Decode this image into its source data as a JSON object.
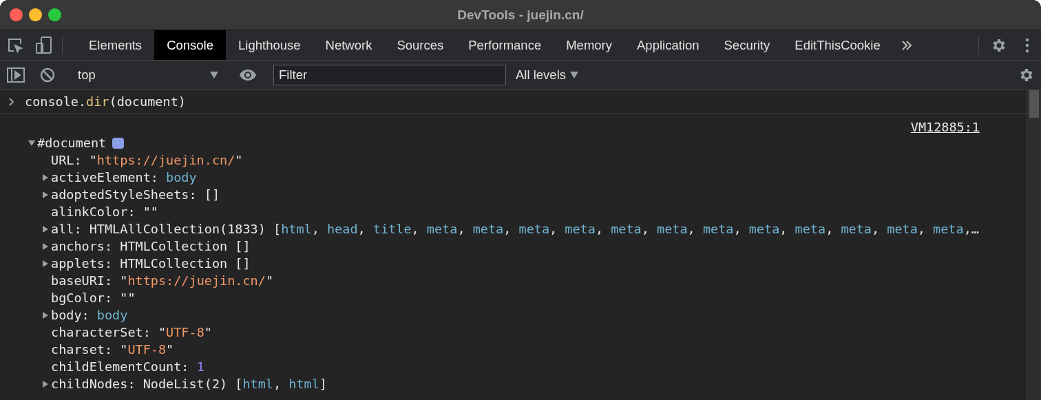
{
  "window": {
    "title": "DevTools - juejin.cn/"
  },
  "tabs": [
    {
      "label": "Elements",
      "selected": false
    },
    {
      "label": "Console",
      "selected": true
    },
    {
      "label": "Lighthouse",
      "selected": false
    },
    {
      "label": "Network",
      "selected": false
    },
    {
      "label": "Sources",
      "selected": false
    },
    {
      "label": "Performance",
      "selected": false
    },
    {
      "label": "Memory",
      "selected": false
    },
    {
      "label": "Application",
      "selected": false
    },
    {
      "label": "Security",
      "selected": false
    },
    {
      "label": "EditThisCookie",
      "selected": false
    }
  ],
  "toolbar": {
    "context": "top",
    "filter": {
      "placeholder": "Filter"
    },
    "levels": "All levels"
  },
  "input": [
    {
      "kind": "plain",
      "text": "console."
    },
    {
      "kind": "method",
      "text": "dir"
    },
    {
      "kind": "plain",
      "text": "(document)"
    }
  ],
  "output": {
    "source_link": "VM12885:1",
    "root": {
      "label": "#document",
      "expanded": true
    },
    "properties": [
      {
        "expandable": false,
        "parts": [
          {
            "kind": "plain",
            "text": "URL: \""
          },
          {
            "kind": "string",
            "text": "https://juejin.cn/"
          },
          {
            "kind": "plain",
            "text": "\""
          }
        ]
      },
      {
        "expandable": true,
        "parts": [
          {
            "kind": "plain",
            "text": "activeElement: "
          },
          {
            "kind": "node",
            "text": "body"
          }
        ]
      },
      {
        "expandable": true,
        "parts": [
          {
            "kind": "plain",
            "text": "adoptedStyleSheets: []"
          }
        ]
      },
      {
        "expandable": false,
        "parts": [
          {
            "kind": "plain",
            "text": "alinkColor: \"\""
          }
        ]
      },
      {
        "expandable": true,
        "parts": [
          {
            "kind": "plain",
            "text": "all: HTMLAllCollection(1833) ["
          },
          {
            "kind": "node",
            "text": "html"
          },
          {
            "kind": "plain",
            "text": ", "
          },
          {
            "kind": "node",
            "text": "head"
          },
          {
            "kind": "plain",
            "text": ", "
          },
          {
            "kind": "node",
            "text": "title"
          },
          {
            "kind": "plain",
            "text": ", "
          },
          {
            "kind": "node",
            "text": "meta"
          },
          {
            "kind": "plain",
            "text": ", "
          },
          {
            "kind": "node",
            "text": "meta"
          },
          {
            "kind": "plain",
            "text": ", "
          },
          {
            "kind": "node",
            "text": "meta"
          },
          {
            "kind": "plain",
            "text": ", "
          },
          {
            "kind": "node",
            "text": "meta"
          },
          {
            "kind": "plain",
            "text": ", "
          },
          {
            "kind": "node",
            "text": "meta"
          },
          {
            "kind": "plain",
            "text": ", "
          },
          {
            "kind": "node",
            "text": "meta"
          },
          {
            "kind": "plain",
            "text": ", "
          },
          {
            "kind": "node",
            "text": "meta"
          },
          {
            "kind": "plain",
            "text": ", "
          },
          {
            "kind": "node",
            "text": "meta"
          },
          {
            "kind": "plain",
            "text": ", "
          },
          {
            "kind": "node",
            "text": "meta"
          },
          {
            "kind": "plain",
            "text": ", "
          },
          {
            "kind": "node",
            "text": "meta"
          },
          {
            "kind": "plain",
            "text": ", "
          },
          {
            "kind": "node",
            "text": "meta"
          },
          {
            "kind": "plain",
            "text": ", "
          },
          {
            "kind": "node",
            "text": "meta"
          },
          {
            "kind": "plain",
            "text": ",…"
          }
        ]
      },
      {
        "expandable": true,
        "parts": [
          {
            "kind": "plain",
            "text": "anchors: HTMLCollection []"
          }
        ]
      },
      {
        "expandable": true,
        "parts": [
          {
            "kind": "plain",
            "text": "applets: HTMLCollection []"
          }
        ]
      },
      {
        "expandable": false,
        "parts": [
          {
            "kind": "plain",
            "text": "baseURI: \""
          },
          {
            "kind": "string",
            "text": "https://juejin.cn/"
          },
          {
            "kind": "plain",
            "text": "\""
          }
        ]
      },
      {
        "expandable": false,
        "parts": [
          {
            "kind": "plain",
            "text": "bgColor: \"\""
          }
        ]
      },
      {
        "expandable": true,
        "parts": [
          {
            "kind": "plain",
            "text": "body: "
          },
          {
            "kind": "node",
            "text": "body"
          }
        ]
      },
      {
        "expandable": false,
        "parts": [
          {
            "kind": "plain",
            "text": "characterSet: \""
          },
          {
            "kind": "string",
            "text": "UTF-8"
          },
          {
            "kind": "plain",
            "text": "\""
          }
        ]
      },
      {
        "expandable": false,
        "parts": [
          {
            "kind": "plain",
            "text": "charset: \""
          },
          {
            "kind": "string",
            "text": "UTF-8"
          },
          {
            "kind": "plain",
            "text": "\""
          }
        ]
      },
      {
        "expandable": false,
        "parts": [
          {
            "kind": "plain",
            "text": "childElementCount: "
          },
          {
            "kind": "number",
            "text": "1"
          }
        ]
      },
      {
        "expandable": true,
        "parts": [
          {
            "kind": "plain",
            "text": "childNodes: NodeList(2) ["
          },
          {
            "kind": "node",
            "text": "html"
          },
          {
            "kind": "plain",
            "text": ", "
          },
          {
            "kind": "node",
            "text": "html"
          },
          {
            "kind": "plain",
            "text": "]"
          }
        ]
      }
    ]
  }
}
